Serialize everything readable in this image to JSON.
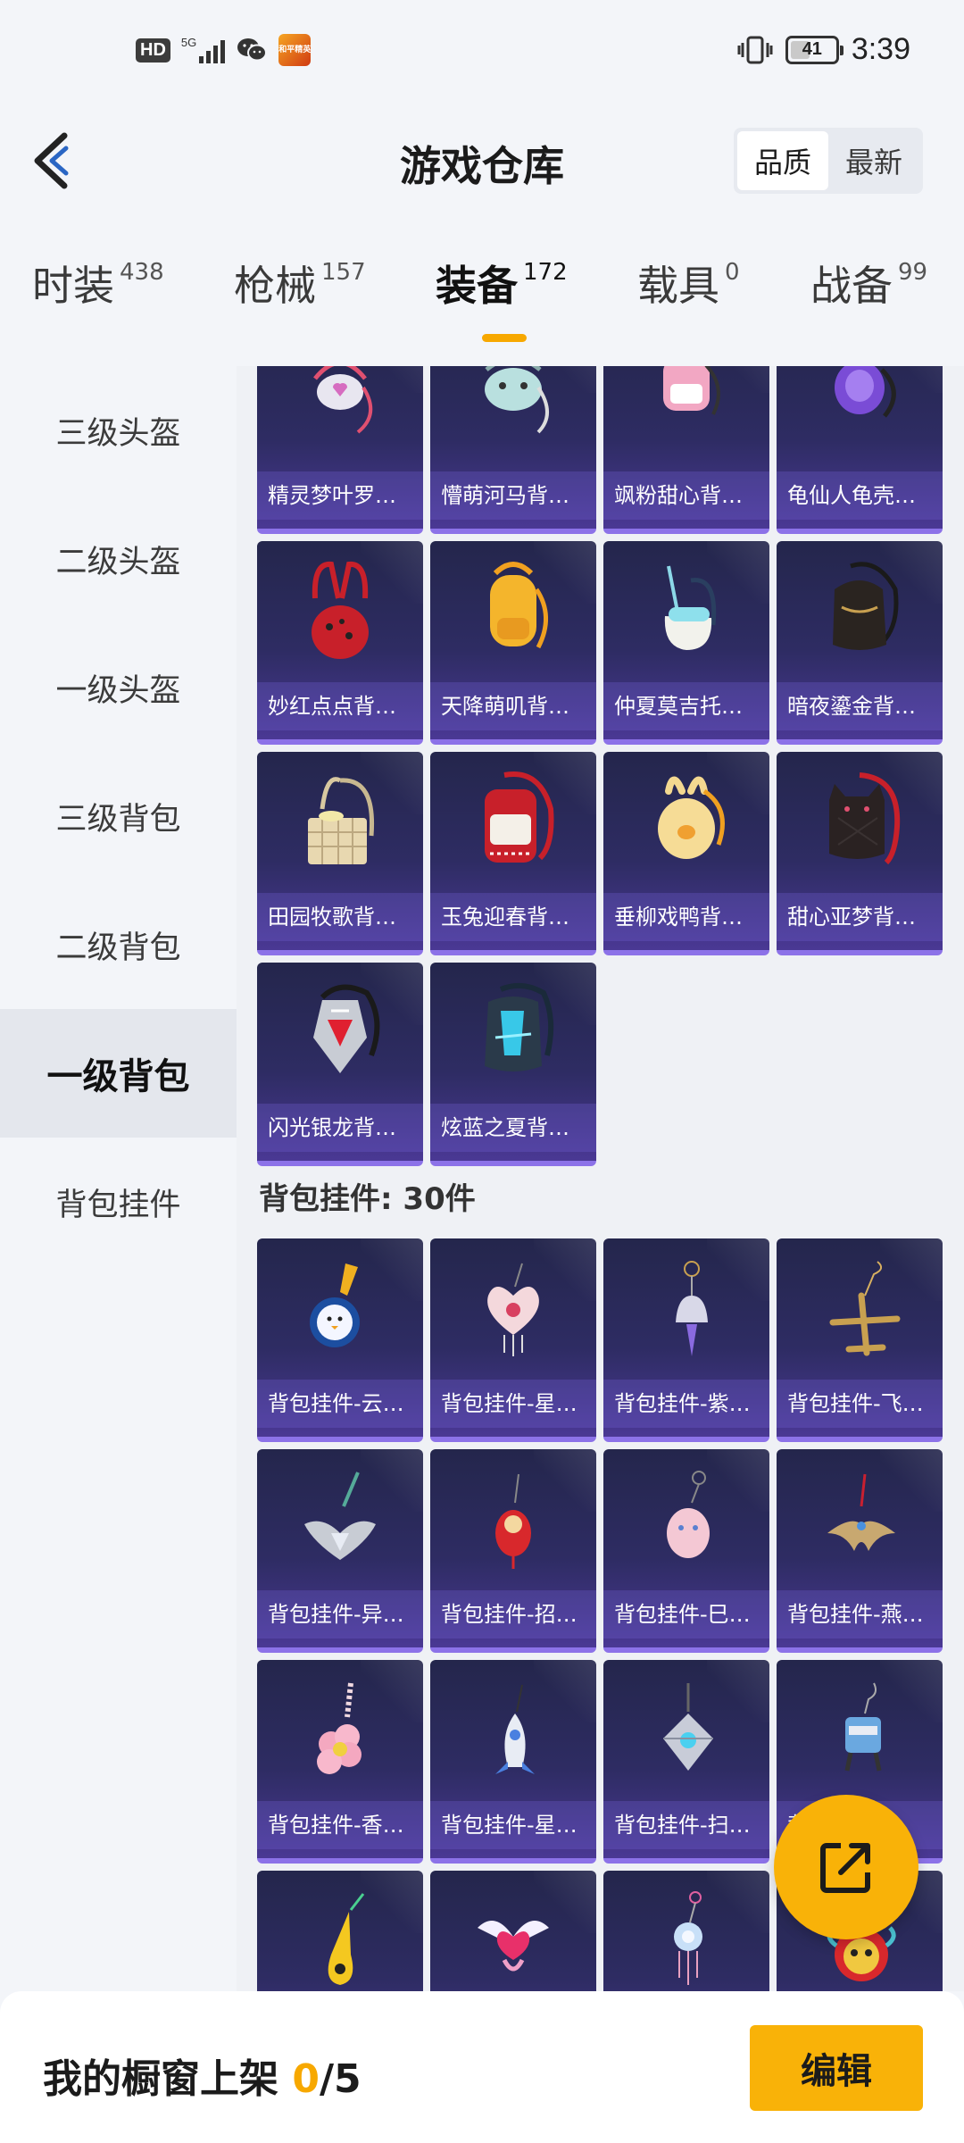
{
  "status_bar": {
    "hd": "HD",
    "network": "5G",
    "battery": "41",
    "time": "3:39",
    "app_badge": "和平精英"
  },
  "header": {
    "title": "游戏仓库",
    "sort_options": [
      "品质",
      "最新"
    ],
    "sort_active": "品质"
  },
  "categories": [
    {
      "label": "时装",
      "count": "438"
    },
    {
      "label": "枪械",
      "count": "157"
    },
    {
      "label": "装备",
      "count": "172",
      "active": true
    },
    {
      "label": "载具",
      "count": "0"
    },
    {
      "label": "战备",
      "count": "99"
    }
  ],
  "sidebar": {
    "items": [
      "三级头盔",
      "二级头盔",
      "一级头盔",
      "三级背包",
      "二级背包",
      "一级背包",
      "背包挂件"
    ],
    "active": "一级背包"
  },
  "backpacks": [
    {
      "name": "精灵梦叶罗丽…",
      "icon": "pendant-backpack"
    },
    {
      "name": "懵萌河马背包…",
      "icon": "hippo-backpack"
    },
    {
      "name": "飒粉甜心背包…",
      "icon": "pink-backpack"
    },
    {
      "name": "龟仙人龟壳背…",
      "icon": "purple-backpack"
    },
    {
      "name": "妙红点点背包…",
      "icon": "red-dot-backpack"
    },
    {
      "name": "天降萌叽背包…",
      "icon": "yellow-backpack"
    },
    {
      "name": "仲夏莫吉托背…",
      "icon": "mojito-backpack"
    },
    {
      "name": "暗夜鎏金背包…",
      "icon": "black-backpack"
    },
    {
      "name": "田园牧歌背包…",
      "icon": "basket-backpack"
    },
    {
      "name": "玉兔迎春背包…",
      "icon": "red-white-backpack"
    },
    {
      "name": "垂柳戏鸭背包…",
      "icon": "duck-backpack"
    },
    {
      "name": "甜心亚梦背包…",
      "icon": "cat-backpack"
    },
    {
      "name": "闪光银龙背包…",
      "icon": "silver-dragon-backpack"
    },
    {
      "name": "炫蓝之夏背包…",
      "icon": "blue-summer-backpack"
    }
  ],
  "charm_section": {
    "title": "背包挂件: 30件"
  },
  "charms": [
    {
      "name": "背包挂件-云…",
      "icon": "cloud-mirror-charm"
    },
    {
      "name": "背包挂件-星…",
      "icon": "heart-charm"
    },
    {
      "name": "背包挂件-紫…",
      "icon": "bell-charm"
    },
    {
      "name": "背包挂件-飞…",
      "icon": "plane-charm"
    },
    {
      "name": "背包挂件-异…",
      "icon": "wing-badge-charm"
    },
    {
      "name": "背包挂件-招…",
      "icon": "lucky-cat-charm"
    },
    {
      "name": "背包挂件-巳…",
      "icon": "snake-charm"
    },
    {
      "name": "背包挂件-燕…",
      "icon": "swallow-charm"
    },
    {
      "name": "背包挂件-香…",
      "icon": "flower-charm"
    },
    {
      "name": "背包挂件-星…",
      "icon": "rocket-charm"
    },
    {
      "name": "背包挂件-扫…",
      "icon": "ghost-charm"
    },
    {
      "name": "背包挂件-…",
      "icon": "robot-charm"
    },
    {
      "name": "",
      "icon": "yellow-charm"
    },
    {
      "name": "",
      "icon": "angel-heart-charm"
    },
    {
      "name": "",
      "icon": "dreamcatcher-charm"
    },
    {
      "name": "",
      "icon": "lion-charm"
    }
  ],
  "bottom_bar": {
    "label": "我的橱窗上架 ",
    "count": "0",
    "total": "/5",
    "edit_label": "编辑"
  },
  "colors": {
    "accent": "#f9b208",
    "card_top": "#24264c",
    "card_bottom": "#4a3894",
    "card_rim": "#8c72e8"
  }
}
